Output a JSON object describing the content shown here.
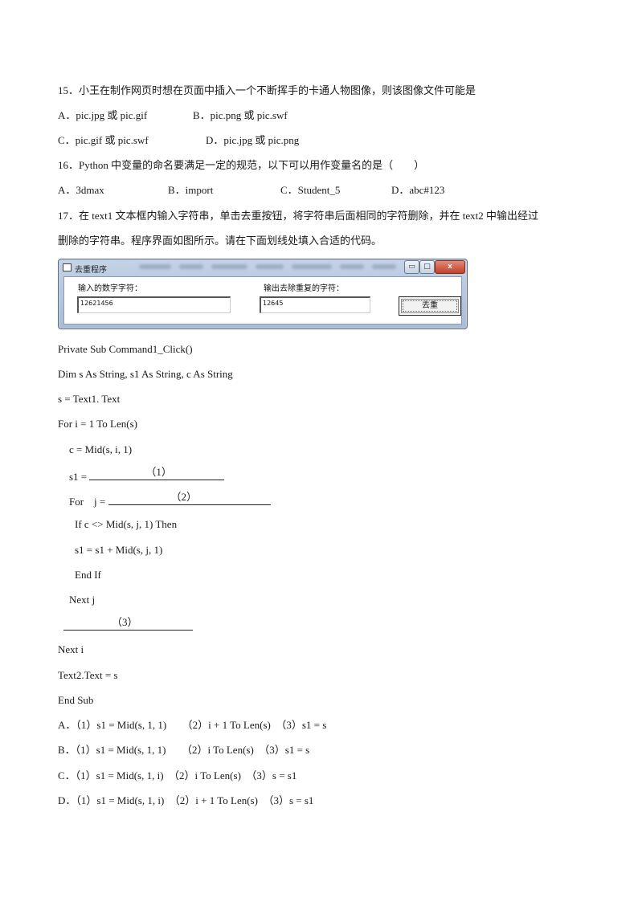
{
  "q15": {
    "stem": "15．小王在制作网页时想在页面中插入一个不断挥手的卡通人物图像，则该图像文件可能是",
    "options": [
      {
        "label": "A．pic.jpg 或 pic.gif"
      },
      {
        "label": "B．pic.png 或 pic.swf"
      },
      {
        "label": "C．pic.gif 或 pic.swf"
      },
      {
        "label": "D．pic.jpg 或 pic.png"
      }
    ]
  },
  "q16": {
    "stem": "16．Python 中变量的命名要满足一定的规范，以下可以用作变量名的是（　　）",
    "options": [
      {
        "label": "A．3dmax"
      },
      {
        "label": "B．import"
      },
      {
        "label": "C．Student_5"
      },
      {
        "label": "D．abc#123"
      }
    ]
  },
  "q17": {
    "stem_line1": "17．在 text1 文本框内输入字符串，单击去重按钮，将字符串后面相同的字符删除，并在 text2 中输出经过",
    "stem_line2": "删除的字符串。程序界面如图所示。请在下面划线处填入合适的代码。",
    "window": {
      "title": "去重程序",
      "input_label": "输入的数字字符：",
      "input_value": "12621456",
      "output_label": "输出去除重复的字符：",
      "output_value": "12645",
      "button_label": "去重",
      "min_glyph": "▭",
      "max_glyph": "□",
      "close_glyph": "x"
    },
    "code": {
      "l1": "Private Sub Command1_Click()",
      "l2": "Dim s As String, s1 As String, c As String",
      "l3": "s = Text1. Text",
      "l4": "For i = 1 To Len(s)",
      "l5": "c = Mid(s, i, 1)",
      "l6_prefix": "s1 = ",
      "blank1": "（1）",
      "l7_prefix": "For　j = ",
      "blank2": "（2）",
      "l8": "If c <> Mid(s, j, 1) Then",
      "l9": "s1 = s1 + Mid(s, j, 1)",
      "l10": "End If",
      "l11": "Next j",
      "blank3": "（3）",
      "l12": "Next i",
      "l13": "Text2.Text = s",
      "l14": "End Sub"
    },
    "options": [
      {
        "label": "A．（1）s1 = Mid(s, 1, 1)　　（2）i + 1 To Len(s)　（3）s1 = s"
      },
      {
        "label": "B．（1）s1 = Mid(s, 1, 1)　　（2）i To Len(s)　（3）s1 = s"
      },
      {
        "label": "C．（1）s1 = Mid(s, 1, i)　（2）i To Len(s)　（3）s = s1"
      },
      {
        "label": "D．（1）s1 = Mid(s, 1, i)　（2）i + 1 To Len(s)　（3）s = s1"
      }
    ]
  }
}
